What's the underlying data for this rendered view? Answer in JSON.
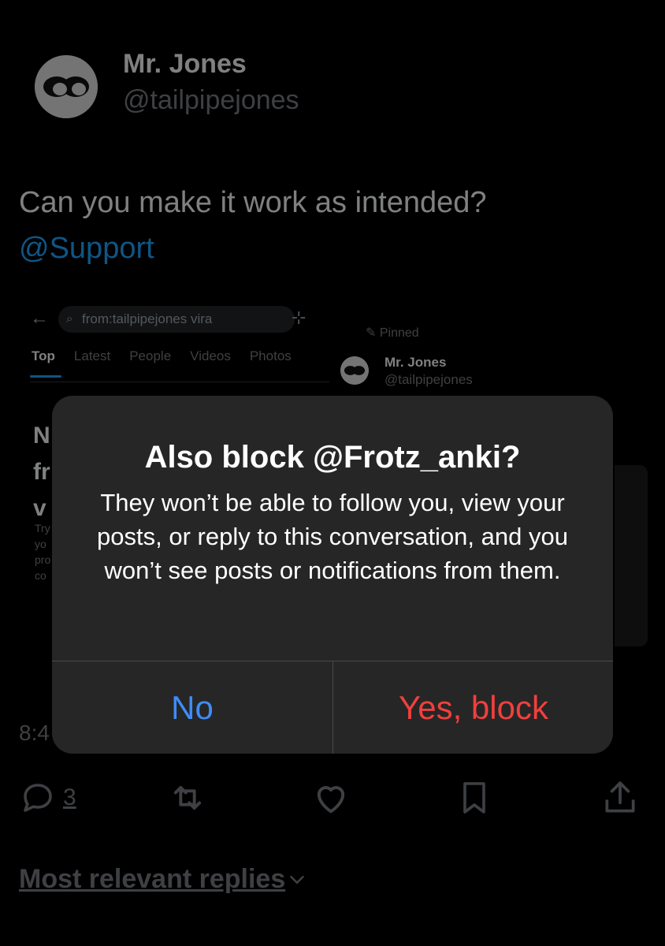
{
  "tweet": {
    "author_name": "Mr. Jones",
    "author_handle": "@tailpipejones",
    "text": "Can you make it work as intended?",
    "mention": "@Support",
    "timestamp_partial": "8:4",
    "reply_count": "3"
  },
  "embedded_screenshot": {
    "search_text": "from:tailpipejones vira",
    "tabs": [
      "Top",
      "Latest",
      "People",
      "Videos",
      "Photos"
    ],
    "active_tab": "Top",
    "pinned_label": "Pinned",
    "mini_name": "Mr. Jones",
    "mini_handle": "@tailpipejones",
    "clipped_heading": [
      "N",
      "fr",
      "v"
    ],
    "clipped_text": [
      "Try",
      "yo",
      "pro",
      "co"
    ]
  },
  "dialog": {
    "title": "Also block @Frotz_anki?",
    "body": "They won’t be able to follow you, view your posts, or reply to this conversation, and you won’t see posts or notifications from them.",
    "no_label": "No",
    "yes_label": "Yes, block"
  },
  "footer": {
    "most_relevant": "Most relevant replies"
  },
  "icons": {
    "reply": "reply-icon",
    "repost": "repost-icon",
    "like": "heart-icon",
    "bookmark": "bookmark-icon",
    "share": "share-icon"
  },
  "colors": {
    "accent": "#1d9bf0",
    "dialog_no": "#3e8df7",
    "dialog_yes": "#f0403d",
    "dialog_bg": "#262626"
  }
}
